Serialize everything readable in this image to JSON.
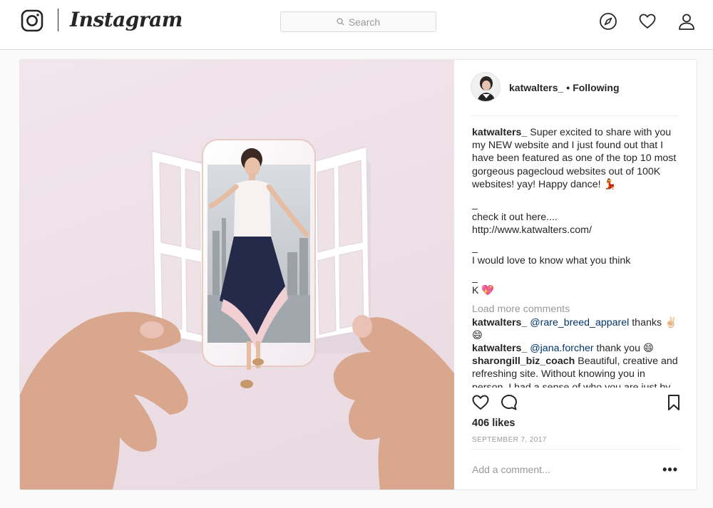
{
  "topnav": {
    "logo_text": "Instagram",
    "search_placeholder": "Search",
    "icons": [
      "instagram-glyph-icon",
      "search-icon",
      "compass-icon",
      "heart-icon",
      "profile-icon"
    ]
  },
  "post": {
    "username": "katwalters_",
    "follow_separator": "•",
    "follow_status": "Following",
    "caption": {
      "username": "katwalters_",
      "line1": "Super excited to share with you my NEW website and I just found out that I have been featured as one of the top 10 most gorgeous pagecloud websites out of 100K websites! yay! Happy dance! 💃",
      "line2": "_",
      "line3": "check it out here....",
      "line4": "http://www.katwalters.com/",
      "line5": "_",
      "line6": "I would love to know what you think",
      "line7": "_",
      "line8": "K 💖"
    },
    "load_more_label": "Load more comments",
    "comments": [
      {
        "user": "katwalters_",
        "mention": "@rare_breed_apparel",
        "text": "thanks ✌🏻😄"
      },
      {
        "user": "katwalters_",
        "mention": "@jana.forcher",
        "text": "thank you 😄"
      },
      {
        "user": "sharongill_biz_coach",
        "mention": "",
        "text": "Beautiful, creative and refreshing site. Without knowing you in person, I had a sense of who you are just by"
      }
    ],
    "likes": "406 likes",
    "date": "SEPTEMBER 7, 2017",
    "add_comment_placeholder": "Add a comment...",
    "more_options": "•••"
  },
  "colors": {
    "text": "#262626",
    "muted": "#999999",
    "mention": "#003569",
    "border": "#dbdbdb",
    "background": "#fafafa"
  }
}
